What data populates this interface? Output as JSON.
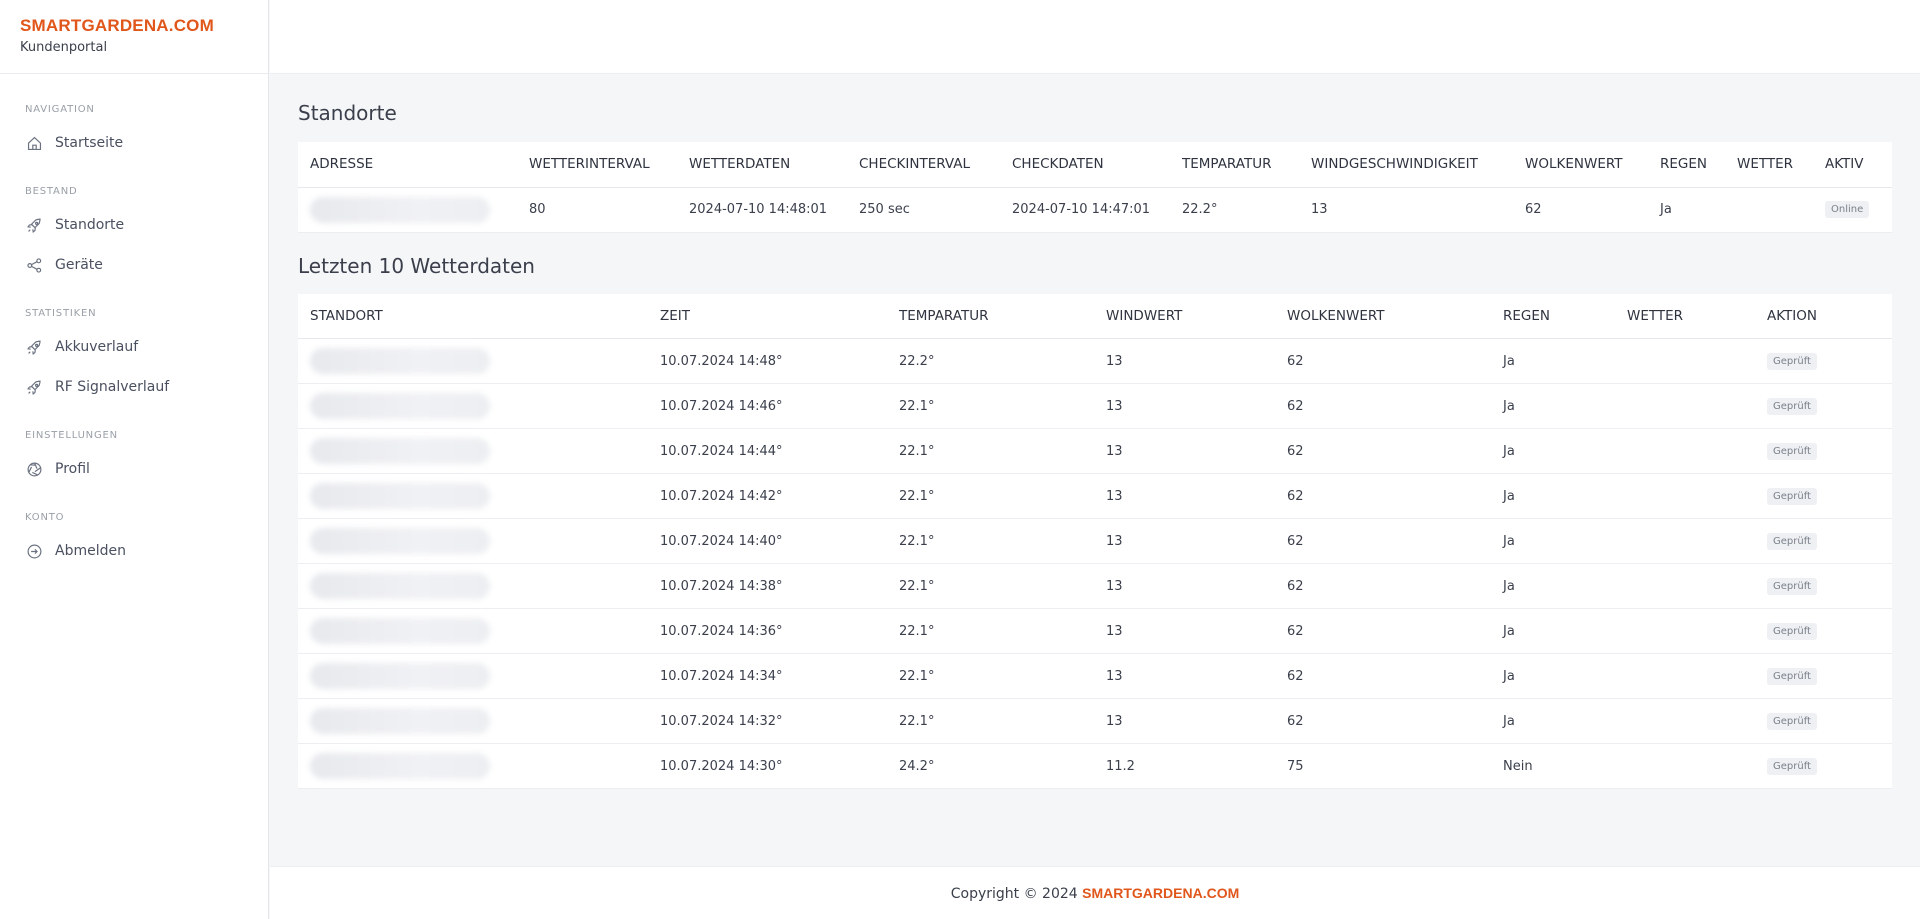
{
  "brand": {
    "title": "SMARTGARDENA.COM",
    "subtitle": "Kundenportal",
    "accent": "#e0561b"
  },
  "nav": {
    "sections": [
      {
        "heading": "NAVIGATION",
        "items": [
          {
            "label": "Startseite",
            "icon": "home-icon"
          }
        ]
      },
      {
        "heading": "BESTAND",
        "items": [
          {
            "label": "Standorte",
            "icon": "rocket-icon"
          },
          {
            "label": "Geräte",
            "icon": "share-icon"
          }
        ]
      },
      {
        "heading": "STATISTIKEN",
        "items": [
          {
            "label": "Akkuverlauf",
            "icon": "rocket-icon"
          },
          {
            "label": "RF Signalverlauf",
            "icon": "rocket-icon"
          }
        ]
      },
      {
        "heading": "EINSTELLUNGEN",
        "items": [
          {
            "label": "Profil",
            "icon": "aperture-icon"
          }
        ]
      },
      {
        "heading": "KONTO",
        "items": [
          {
            "label": "Abmelden",
            "icon": "logout-icon"
          }
        ]
      }
    ]
  },
  "standorte": {
    "title": "Standorte",
    "columns": [
      "ADRESSE",
      "WETTERINTERVAL",
      "WETTERDATEN",
      "CHECKINTERVAL",
      "CHECKDATEN",
      "TEMPARATUR",
      "WINDGESCHWINDIGKEIT",
      "WOLKENWERT",
      "REGEN",
      "WETTER",
      "AKTIV"
    ],
    "rows": [
      {
        "adresse": "",
        "wetterinterval": "80",
        "wetterdaten": "2024-07-10 14:48:01",
        "checkinterval": "250 sec",
        "checkdaten": "2024-07-10 14:47:01",
        "temparatur": "22.2°",
        "wind": "13",
        "wolken": "62",
        "regen": "Ja",
        "wetter": "",
        "aktiv": "Online"
      }
    ]
  },
  "wetter": {
    "title": "Letzten 10 Wetterdaten",
    "columns": [
      "STANDORT",
      "ZEIT",
      "TEMPARATUR",
      "WINDWERT",
      "WOLKENWERT",
      "REGEN",
      "WETTER",
      "AKTION"
    ],
    "rows": [
      {
        "zeit": "10.07.2024 14:48°",
        "temp": "22.2°",
        "wind": "13",
        "wolken": "62",
        "regen": "Ja",
        "wetter": "",
        "aktion": "Geprüft"
      },
      {
        "zeit": "10.07.2024 14:46°",
        "temp": "22.1°",
        "wind": "13",
        "wolken": "62",
        "regen": "Ja",
        "wetter": "",
        "aktion": "Geprüft"
      },
      {
        "zeit": "10.07.2024 14:44°",
        "temp": "22.1°",
        "wind": "13",
        "wolken": "62",
        "regen": "Ja",
        "wetter": "",
        "aktion": "Geprüft"
      },
      {
        "zeit": "10.07.2024 14:42°",
        "temp": "22.1°",
        "wind": "13",
        "wolken": "62",
        "regen": "Ja",
        "wetter": "",
        "aktion": "Geprüft"
      },
      {
        "zeit": "10.07.2024 14:40°",
        "temp": "22.1°",
        "wind": "13",
        "wolken": "62",
        "regen": "Ja",
        "wetter": "",
        "aktion": "Geprüft"
      },
      {
        "zeit": "10.07.2024 14:38°",
        "temp": "22.1°",
        "wind": "13",
        "wolken": "62",
        "regen": "Ja",
        "wetter": "",
        "aktion": "Geprüft"
      },
      {
        "zeit": "10.07.2024 14:36°",
        "temp": "22.1°",
        "wind": "13",
        "wolken": "62",
        "regen": "Ja",
        "wetter": "",
        "aktion": "Geprüft"
      },
      {
        "zeit": "10.07.2024 14:34°",
        "temp": "22.1°",
        "wind": "13",
        "wolken": "62",
        "regen": "Ja",
        "wetter": "",
        "aktion": "Geprüft"
      },
      {
        "zeit": "10.07.2024 14:32°",
        "temp": "22.1°",
        "wind": "13",
        "wolken": "62",
        "regen": "Ja",
        "wetter": "",
        "aktion": "Geprüft"
      },
      {
        "zeit": "10.07.2024 14:30°",
        "temp": "24.2°",
        "wind": "11.2",
        "wolken": "75",
        "regen": "Nein",
        "wetter": "",
        "aktion": "Geprüft"
      }
    ]
  },
  "footer": {
    "prefix": "Copyright © 2024 ",
    "brand": "SMARTGARDENA.COM"
  }
}
